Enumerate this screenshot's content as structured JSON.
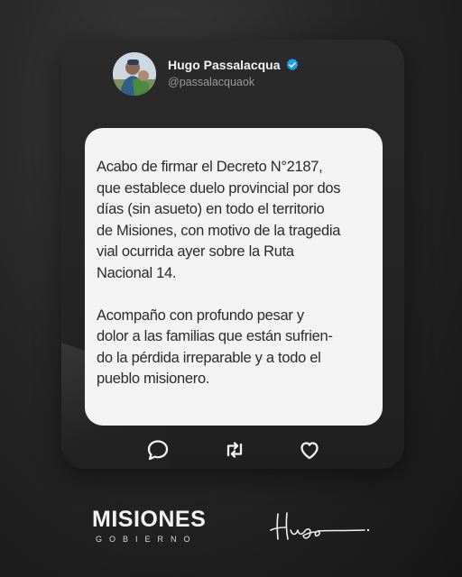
{
  "profile": {
    "name": "Hugo Passalacqua",
    "handle": "@passalacquaok"
  },
  "post": {
    "paragraphs": [
      "Acabo de firmar el Decreto N°2187,\nque establece duelo provincial por dos\ndías (sin asueto) en todo el territorio\nde Misiones, con motivo de la tragedia\nvial ocurrida ayer sobre la Ruta\nNacional 14.",
      "Acompaño con profundo pesar y\ndolor a las familias que están sufrien-\ndo la pérdida irreparable y a todo el\npueblo misionero."
    ]
  },
  "actions": {
    "reply_icon": "comment-icon",
    "retweet_icon": "retweet-icon",
    "like_icon": "heart-icon"
  },
  "footer": {
    "logo_main": "MISIONES",
    "logo_sub": "GOBIERNO",
    "signature": "Hugo"
  },
  "colors": {
    "verified": "#1d9bf0",
    "bubble": "#f3f3f4",
    "text": "#2b2b2b"
  }
}
